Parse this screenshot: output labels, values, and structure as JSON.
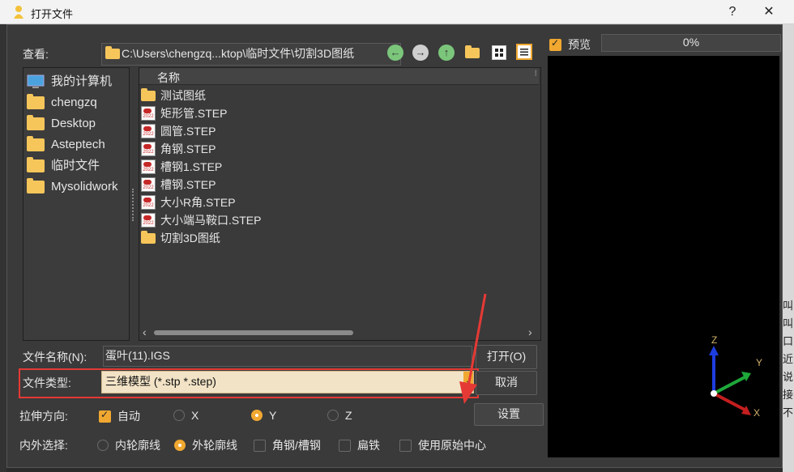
{
  "window": {
    "title": "打开文件",
    "help_label": "?",
    "close_label": "✕"
  },
  "lookin": {
    "label": "查看:",
    "path": "C:\\Users\\chengzq...ktop\\临时文件\\切割3D图纸"
  },
  "nav_icons": [
    "back-arrow-icon",
    "forward-arrow-icon",
    "up-arrow-icon",
    "new-folder-icon",
    "grid-view-icon",
    "list-view-icon"
  ],
  "sidebar": {
    "items": [
      {
        "label": "我的计算机",
        "icon": "computer-icon"
      },
      {
        "label": "chengzq",
        "icon": "folder-icon"
      },
      {
        "label": "Desktop",
        "icon": "folder-icon"
      },
      {
        "label": "Asteptech",
        "icon": "folder-icon"
      },
      {
        "label": "临时文件",
        "icon": "folder-icon"
      },
      {
        "label": "Mysolidwork",
        "icon": "folder-icon"
      }
    ]
  },
  "filelist": {
    "header": "名称",
    "rows": [
      {
        "name": "测试图纸",
        "icon": "folder-icon"
      },
      {
        "name": "矩形管.STEP",
        "icon": "solidworks-file-icon"
      },
      {
        "name": "圆管.STEP",
        "icon": "solidworks-file-icon"
      },
      {
        "name": "角钢.STEP",
        "icon": "solidworks-file-icon"
      },
      {
        "name": "槽钢1.STEP",
        "icon": "solidworks-file-icon"
      },
      {
        "name": "槽钢.STEP",
        "icon": "solidworks-file-icon"
      },
      {
        "name": "大小R角.STEP",
        "icon": "solidworks-file-icon"
      },
      {
        "name": "大小端马鞍口.STEP",
        "icon": "solidworks-file-icon"
      },
      {
        "name": "切割3D图纸",
        "icon": "folder-icon"
      }
    ]
  },
  "filename": {
    "label": "文件名称(N):",
    "value": "蛋叶(11).IGS"
  },
  "filetype": {
    "label": "文件类型:",
    "value": "三维模型 (*.stp *.step)"
  },
  "buttons": {
    "open": "打开(O)",
    "cancel": "取消",
    "settings": "设置"
  },
  "extrude": {
    "label": "拉伸方向:",
    "auto": "自动",
    "x": "X",
    "y": "Y",
    "z": "Z",
    "selected": "Y",
    "auto_checked": true
  },
  "inout": {
    "label": "内外选择:",
    "inner": "内轮廓线",
    "outer": "外轮廓线",
    "angle": "角钢/槽钢",
    "flat": "扁铁",
    "origin": "使用原始中心",
    "selected": "外轮廓线"
  },
  "preview": {
    "label": "预览",
    "checked": true,
    "progress_text": "0%",
    "progress": 0
  },
  "axes": {
    "x": "X",
    "y": "Y",
    "z": "Z"
  },
  "backdrop_glyphs": [
    "叫",
    "叫",
    "口",
    "近",
    "说",
    "接",
    "不"
  ],
  "colors": {
    "accent": "#f0a830",
    "highlight_border": "#e53935",
    "filetype_bg": "#f2e3c6"
  }
}
